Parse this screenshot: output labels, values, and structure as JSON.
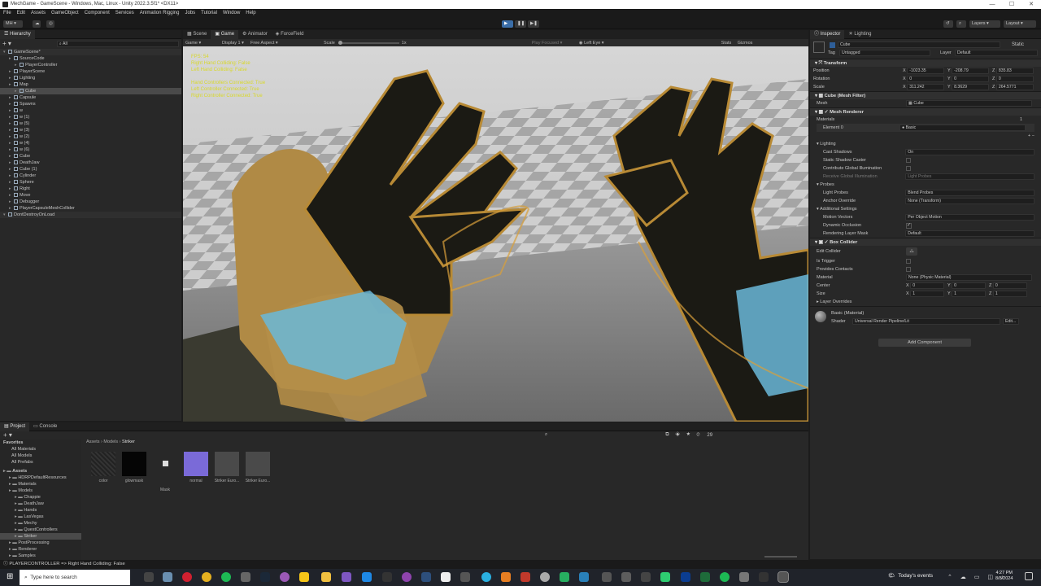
{
  "window": {
    "title": "MechGame - GameScene - Windows, Mac, Linux - Unity 2022.3.5f1* <DX11>",
    "min": "—",
    "max": "☐",
    "close": "✕"
  },
  "menu": [
    "File",
    "Edit",
    "Assets",
    "GameObject",
    "Component",
    "Services",
    "Animation Rigging",
    "Jobs",
    "Tutorial",
    "Window",
    "Help"
  ],
  "toolbar": {
    "account": "MH ▾",
    "layers": "Layers",
    "layout": "Layout"
  },
  "hierarchy": {
    "tab": "Hierarchy",
    "search": "All",
    "items": [
      {
        "t": "GameScene*",
        "d": 0,
        "s": false,
        "r": true
      },
      {
        "t": "SourceCode",
        "d": 1,
        "s": false,
        "r": false
      },
      {
        "t": "PlayerController",
        "d": 2,
        "s": false,
        "r": false
      },
      {
        "t": "PlayerScene",
        "d": 1,
        "s": false,
        "r": false
      },
      {
        "t": "Lighting",
        "d": 1,
        "s": false,
        "r": false
      },
      {
        "t": "Map",
        "d": 1,
        "s": false,
        "r": false
      },
      {
        "t": "Cube",
        "d": 2,
        "s": true,
        "r": false
      },
      {
        "t": "Capsule",
        "d": 1,
        "s": false,
        "r": false
      },
      {
        "t": "Spawns",
        "d": 1,
        "s": false,
        "r": false
      },
      {
        "t": "w",
        "d": 1,
        "s": false,
        "r": false
      },
      {
        "t": "w (1)",
        "d": 1,
        "s": false,
        "r": false
      },
      {
        "t": "w (5)",
        "d": 1,
        "s": false,
        "r": false
      },
      {
        "t": "w (3)",
        "d": 1,
        "s": false,
        "r": false
      },
      {
        "t": "w (2)",
        "d": 1,
        "s": false,
        "r": false
      },
      {
        "t": "w (4)",
        "d": 1,
        "s": false,
        "r": false
      },
      {
        "t": "w (6)",
        "d": 1,
        "s": false,
        "r": false
      },
      {
        "t": "Cube",
        "d": 1,
        "s": false,
        "r": false
      },
      {
        "t": "DeathJaw",
        "d": 1,
        "s": false,
        "r": false
      },
      {
        "t": "Cube (1)",
        "d": 1,
        "s": false,
        "r": false
      },
      {
        "t": "Cylinder",
        "d": 1,
        "s": false,
        "r": false
      },
      {
        "t": "Sphere",
        "d": 1,
        "s": false,
        "r": false
      },
      {
        "t": "Right",
        "d": 1,
        "s": false,
        "r": false
      },
      {
        "t": "Move",
        "d": 1,
        "s": false,
        "r": false
      },
      {
        "t": "Debugger",
        "d": 1,
        "s": false,
        "r": false
      },
      {
        "t": "PlayerCapsuleMeshCollider",
        "d": 1,
        "s": false,
        "r": false
      },
      {
        "t": "DontDestroyOnLoad",
        "d": 0,
        "s": false,
        "r": true
      }
    ]
  },
  "center_tabs": [
    "Scene",
    "Game",
    "Animator",
    "ForceField"
  ],
  "game_bar": {
    "mode": "Game",
    "display": "Display 1",
    "aspect": "Free Aspect",
    "scale_label": "Scale",
    "scale_value": "1x",
    "play_focused": "Play Focused",
    "eye": "Left Eye",
    "stats": "Stats",
    "gizmos": "Gizmos"
  },
  "overlay": [
    "FPS: 54",
    "Right Hand Colliding: False",
    "Left Hand Colliding: False",
    "",
    "Hand Controllers Connected: True",
    "Left Controller Connected: True",
    "Right Controller Connected: True"
  ],
  "inspector": {
    "tabs": [
      "Inspector",
      "Lighting"
    ],
    "name": "Cube",
    "static": "Static",
    "tag_label": "Tag",
    "tag": "Untagged",
    "layer_label": "Layer",
    "layer": "Default",
    "transform": {
      "title": "Transform",
      "rows": [
        {
          "l": "Position",
          "x": "-1023.35",
          "y": "-208.79",
          "z": "835.83"
        },
        {
          "l": "Rotation",
          "x": "0",
          "y": "0",
          "z": "0"
        },
        {
          "l": "Scale",
          "x": "311.242",
          "y": "8.3629",
          "z": "264.5771"
        }
      ]
    },
    "mesh_filter": {
      "title": "Cube (Mesh Filter)",
      "mesh_label": "Mesh",
      "mesh": "Cube"
    },
    "mesh_renderer": {
      "title": "Mesh Renderer",
      "materials": "Materials",
      "count": "1",
      "element": "Element 0",
      "element_val": "Basic",
      "lighting": "Lighting",
      "cast": "Cast Shadows",
      "cast_val": "On",
      "static_sc": "Static Shadow Caster",
      "contrib": "Contribute Global Illumination",
      "receive": "Receive Global Illumination",
      "receive_val": "Light Probes",
      "probes": "Probes",
      "lp": "Light Probes",
      "lp_val": "Blend Probes",
      "ao": "Anchor Override",
      "ao_val": "None (Transform)",
      "add": "Additional Settings",
      "mv": "Motion Vectors",
      "mv_val": "Per Object Motion",
      "dyn": "Dynamic Occlusion",
      "rlm": "Rendering Layer Mask",
      "rlm_val": "Default"
    },
    "box_collider": {
      "title": "Box Collider",
      "edit": "Edit Collider",
      "trigger": "Is Trigger",
      "contacts": "Provides Contacts",
      "mat": "Material",
      "mat_val": "None (Physic Material)",
      "center": "Center",
      "cx": "0",
      "cy": "0",
      "cz": "0",
      "size": "Size",
      "sx": "1",
      "sy": "1",
      "sz": "1",
      "overrides": "Layer Overrides"
    },
    "material": {
      "title": "Basic (Material)",
      "shader_label": "Shader",
      "shader": "Universal Render Pipeline/Lit",
      "edit": "Edit..."
    },
    "add_component": "Add Component"
  },
  "project": {
    "tabs": [
      "Project",
      "Console"
    ],
    "breadcrumb": [
      "Assets",
      "Models",
      "Striker"
    ],
    "favorites": [
      "Favorites",
      "All Materials",
      "All Models",
      "All Prefabs"
    ],
    "tree": [
      {
        "t": "Assets",
        "d": 0
      },
      {
        "t": "HDRPDefaultResources",
        "d": 1
      },
      {
        "t": "Materials",
        "d": 1
      },
      {
        "t": "Models",
        "d": 1
      },
      {
        "t": "Chappie",
        "d": 2
      },
      {
        "t": "DeathJaw",
        "d": 2
      },
      {
        "t": "Hands",
        "d": 2
      },
      {
        "t": "LasVegas",
        "d": 2
      },
      {
        "t": "Mechy",
        "d": 2
      },
      {
        "t": "QuestControllers",
        "d": 2
      },
      {
        "t": "Striker",
        "d": 2
      },
      {
        "t": "PostProcessing",
        "d": 1
      },
      {
        "t": "Renderer",
        "d": 1
      },
      {
        "t": "Samples",
        "d": 1
      }
    ],
    "assets": [
      {
        "n": "color",
        "c": "#2a2a2a"
      },
      {
        "n": "glowmask",
        "c": "#050505"
      },
      {
        "n": "Mask",
        "c": "#2a2a2a"
      },
      {
        "n": "normal",
        "c": "#7a6ad8"
      },
      {
        "n": "Striker Euro...",
        "c": "#4a4a4a"
      },
      {
        "n": "Striker Euro...",
        "c": "#4a4a4a"
      }
    ],
    "count": "29"
  },
  "status": "PLAYERCONTROLLER => Right Hand Colliding: False",
  "taskbar": {
    "search": "Type here to search",
    "news": "Today's events",
    "time": "4:27 PM",
    "date": "8/8/2024"
  }
}
